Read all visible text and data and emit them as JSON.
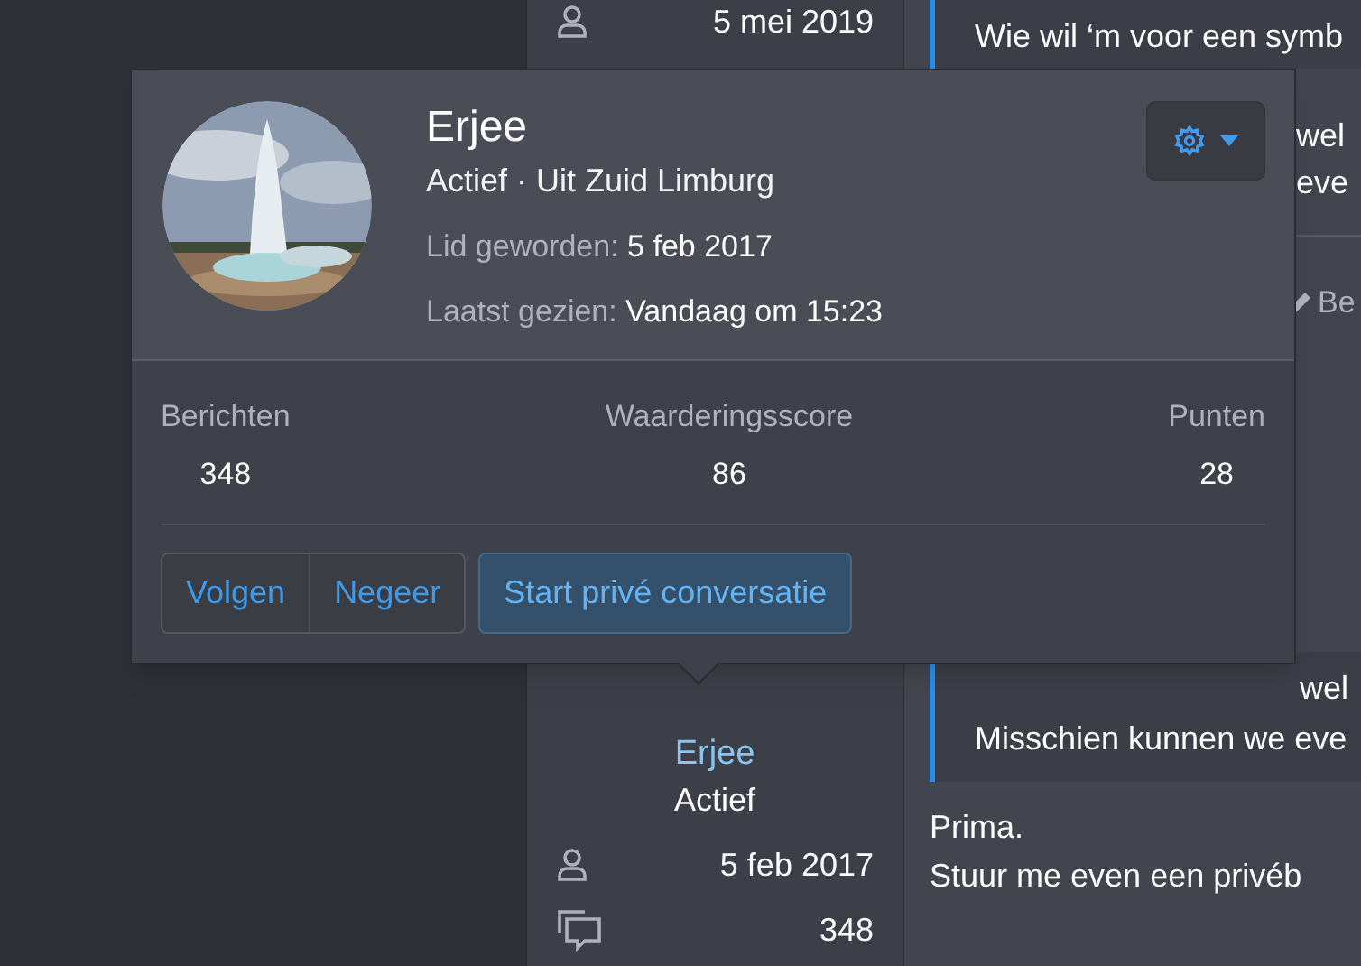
{
  "user_column": {
    "top_stat": {
      "kind": "joined",
      "value": "5 mei 2019"
    },
    "author": {
      "name": "Erjee",
      "title": "Actief"
    },
    "stats": [
      {
        "kind": "joined",
        "value": "5 feb 2017"
      },
      {
        "kind": "messages",
        "value": "348"
      }
    ]
  },
  "posts": {
    "top_quote": "Wie wil ‘m voor een symb",
    "fragments": [
      "wel",
      "eve"
    ],
    "edit_link": "Be",
    "bottom_quote": [
      "wel",
      "Misschien kunnen we eve"
    ],
    "reply": [
      "Prima.",
      "Stuur me even een privéb"
    ]
  },
  "profile_popup": {
    "name": "Erjee",
    "subtitle": "Actief · Uit Zuid Limburg",
    "facts": [
      {
        "label": "Lid geworden:",
        "value": "5 feb 2017"
      },
      {
        "label": "Laatst gezien:",
        "value": "Vandaag om 15:23"
      }
    ],
    "stats": [
      {
        "label": "Berichten",
        "value": "348"
      },
      {
        "label": "Waarderingsscore",
        "value": "86"
      },
      {
        "label": "Punten",
        "value": "28"
      }
    ],
    "buttons": [
      {
        "label": "Volgen",
        "kind": "group"
      },
      {
        "label": "Negeer",
        "kind": "group"
      },
      {
        "label": "Start privé conversatie",
        "kind": "primary"
      }
    ]
  }
}
